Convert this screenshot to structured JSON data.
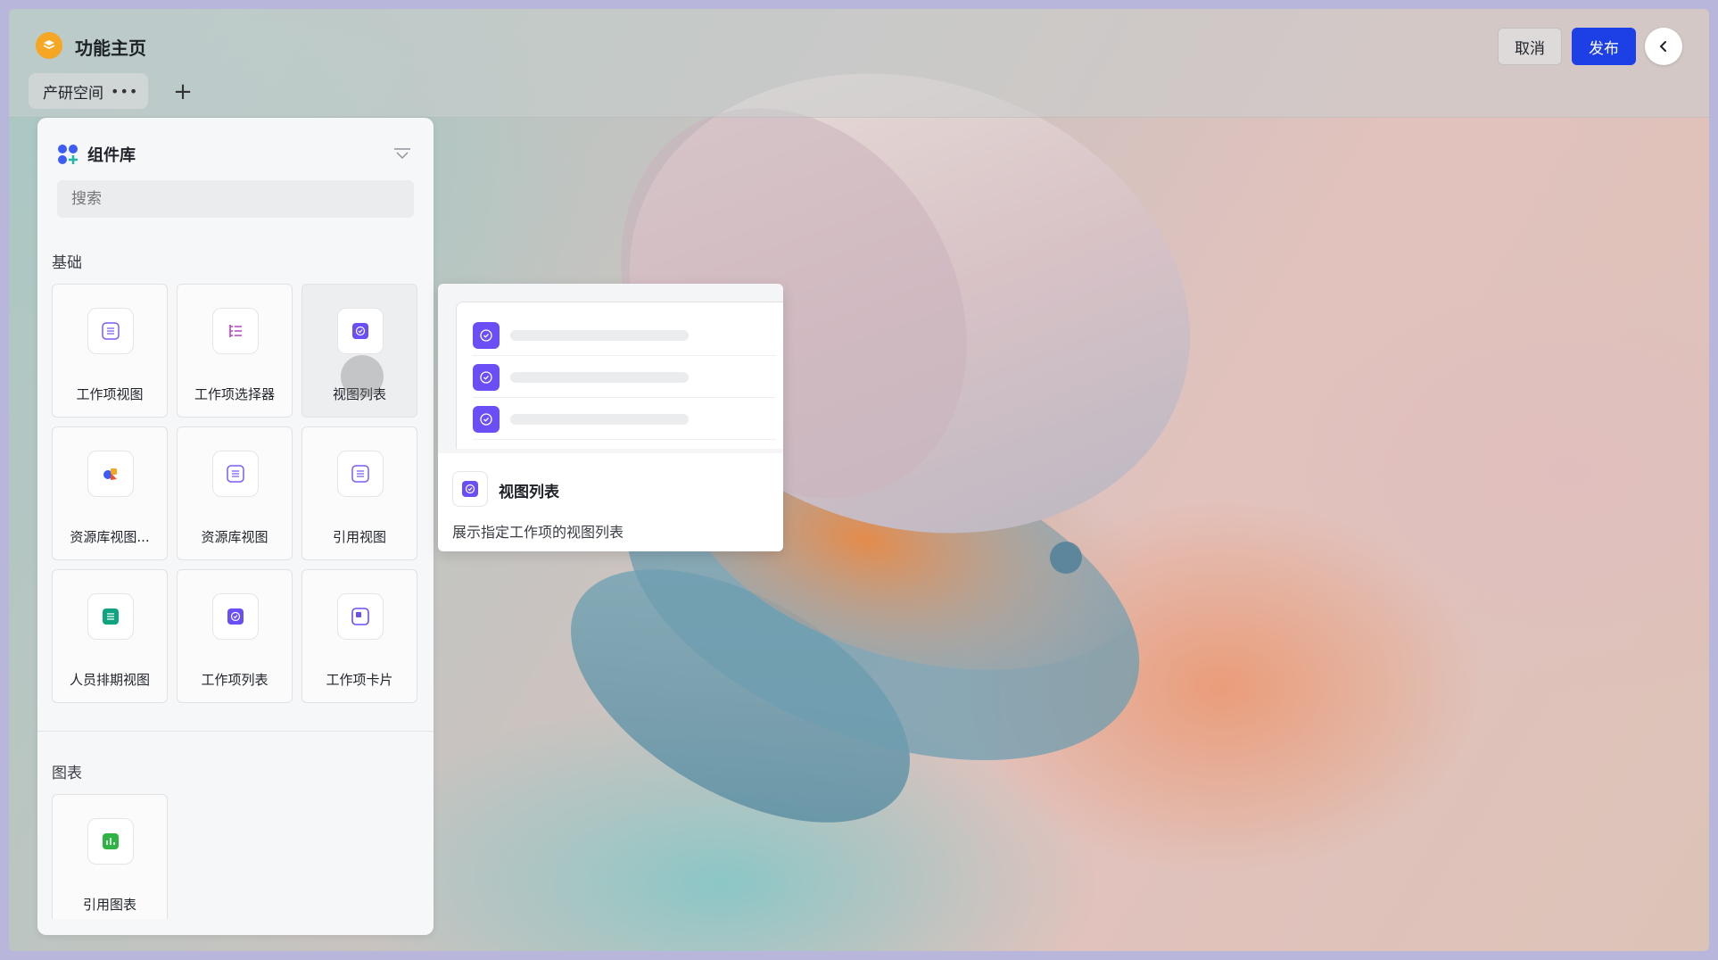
{
  "header": {
    "title": "功能主页",
    "tab_label": "产研空间",
    "tab_more": "•••",
    "add_tab": "+",
    "cancel_label": "取消",
    "publish_label": "发布"
  },
  "panel": {
    "title": "组件库",
    "search_placeholder": "搜索",
    "sections": {
      "basic": {
        "label": "基础",
        "items": [
          {
            "label": "工作项视图",
            "icon": "list-doc-icon",
            "color": "#7c5cf5"
          },
          {
            "label": "工作项选择器",
            "icon": "tree-list-icon",
            "color": "#c13fd1"
          },
          {
            "label": "视图列表",
            "icon": "check-square-icon",
            "color": "#6b4ef5"
          },
          {
            "label": "资源库视图...",
            "icon": "colorful-shapes-icon",
            "color": "#e8552b"
          },
          {
            "label": "资源库视图",
            "icon": "list-doc-icon",
            "color": "#7c5cf5"
          },
          {
            "label": "引用视图",
            "icon": "list-doc-icon",
            "color": "#7c5cf5"
          },
          {
            "label": "人员排期视图",
            "icon": "calendar-grid-icon",
            "color": "#0fa37f"
          },
          {
            "label": "工作项列表",
            "icon": "check-square-icon",
            "color": "#6b4ef5"
          },
          {
            "label": "工作项卡片",
            "icon": "card-icon",
            "color": "#6b4ef5"
          }
        ]
      },
      "chart": {
        "label": "图表",
        "items": [
          {
            "label": "引用图表",
            "icon": "bar-chart-icon",
            "color": "#2fb344"
          }
        ]
      }
    }
  },
  "tooltip": {
    "title": "视图列表",
    "description": "展示指定工作项的视图列表"
  }
}
